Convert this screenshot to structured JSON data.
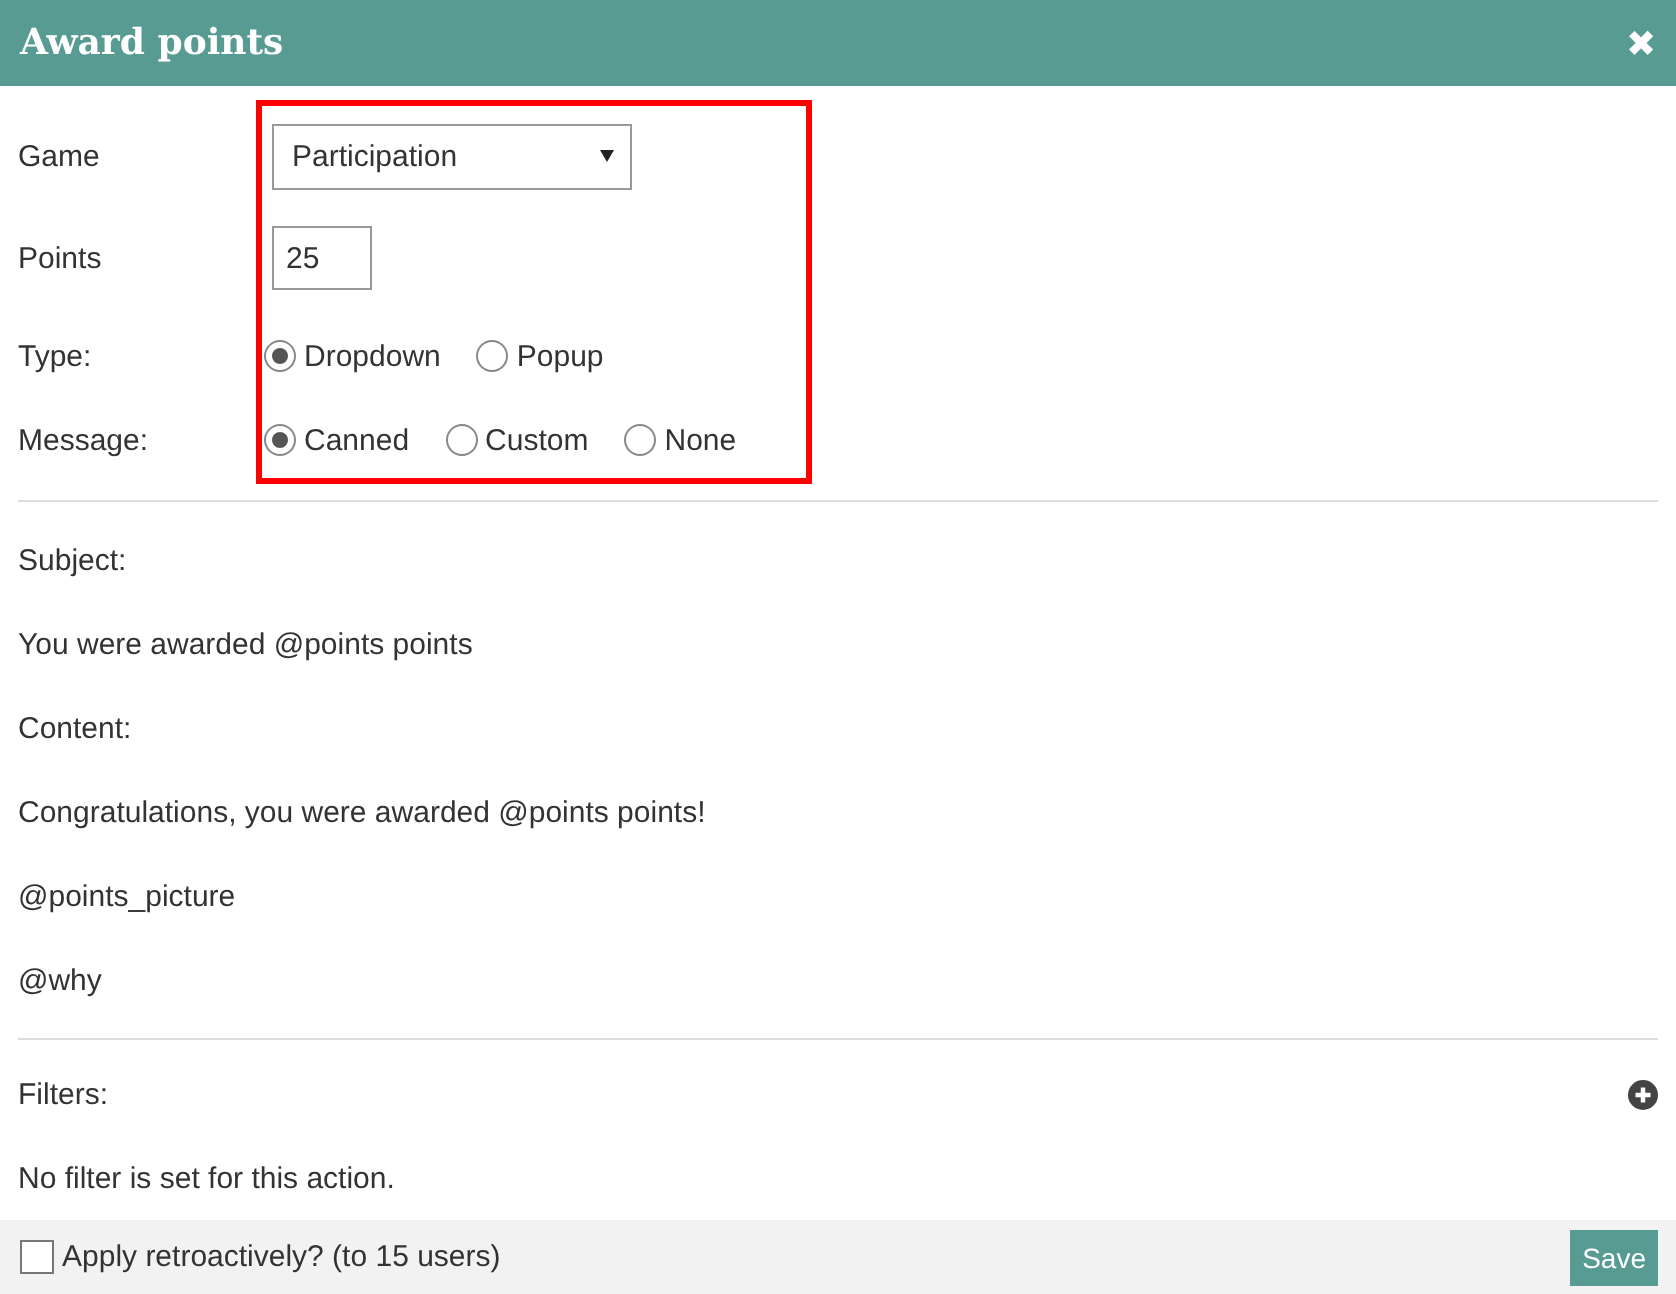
{
  "dialog": {
    "title": "Award points",
    "close": "✖"
  },
  "form": {
    "game": {
      "label": "Game",
      "value": "Participation"
    },
    "points": {
      "label": "Points",
      "value": "25"
    },
    "type": {
      "label": "Type:",
      "options": [
        {
          "label": "Dropdown",
          "selected": true
        },
        {
          "label": "Popup",
          "selected": false
        }
      ]
    },
    "message": {
      "label": "Message:",
      "options": [
        {
          "label": "Canned",
          "selected": true
        },
        {
          "label": "Custom",
          "selected": false
        },
        {
          "label": "None",
          "selected": false
        }
      ]
    }
  },
  "message_preview": [
    "Subject:",
    "You were awarded @points points",
    "Content:",
    "Congratulations, you were awarded @points points!",
    "@points_picture",
    "@why"
  ],
  "filters": {
    "label": "Filters:",
    "empty_text": "No filter is set for this action."
  },
  "footer": {
    "retroactive": {
      "label": "Apply retroactively? (to 15 users)",
      "checked": false
    },
    "save": "Save"
  }
}
